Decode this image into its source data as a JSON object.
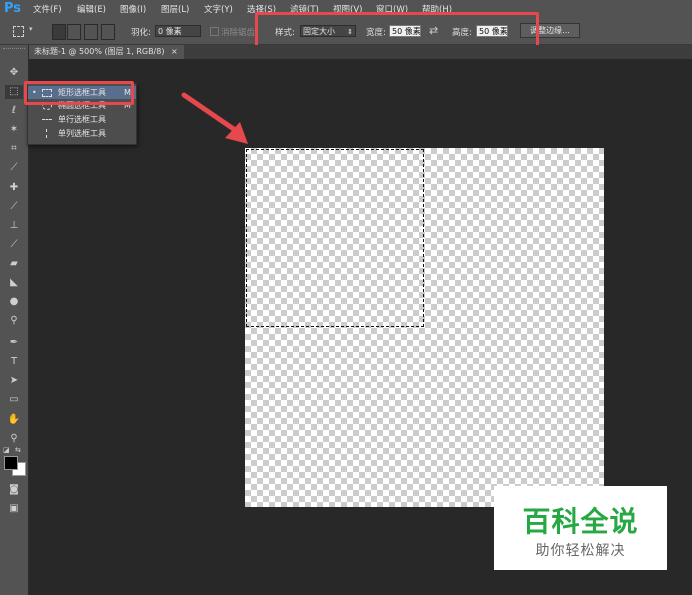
{
  "app": {
    "logo": "Ps"
  },
  "menu": [
    "文件(F)",
    "编辑(E)",
    "图像(I)",
    "图层(L)",
    "文字(Y)",
    "选择(S)",
    "滤镜(T)",
    "视图(V)",
    "窗口(W)",
    "帮助(H)"
  ],
  "options": {
    "feather_label": "羽化:",
    "feather_value": "0 像素",
    "antialias_label": "消除锯齿",
    "style_label": "样式:",
    "style_value": "固定大小",
    "width_label": "宽度:",
    "width_value": "50 像素",
    "swap_icon": "⇄",
    "height_label": "高度:",
    "height_value": "50 像素",
    "refine_edge": "调整边缘..."
  },
  "document_tab": {
    "title": "未标题-1 @ 500% (图层 1, RGB/8)",
    "close": "×"
  },
  "flyout": {
    "items": [
      {
        "label": "矩形选框工具",
        "shortcut": "M",
        "selected": true
      },
      {
        "label": "椭圆选框工具",
        "shortcut": "M",
        "selected": false
      },
      {
        "label": "单行选框工具",
        "shortcut": "",
        "selected": false
      },
      {
        "label": "单列选框工具",
        "shortcut": "",
        "selected": false
      }
    ]
  },
  "watermark": {
    "title": "百科全说",
    "subtitle": "助你轻松解决"
  },
  "colors": {
    "annotation": "#e5484d",
    "watermark_green": "#27a844"
  }
}
